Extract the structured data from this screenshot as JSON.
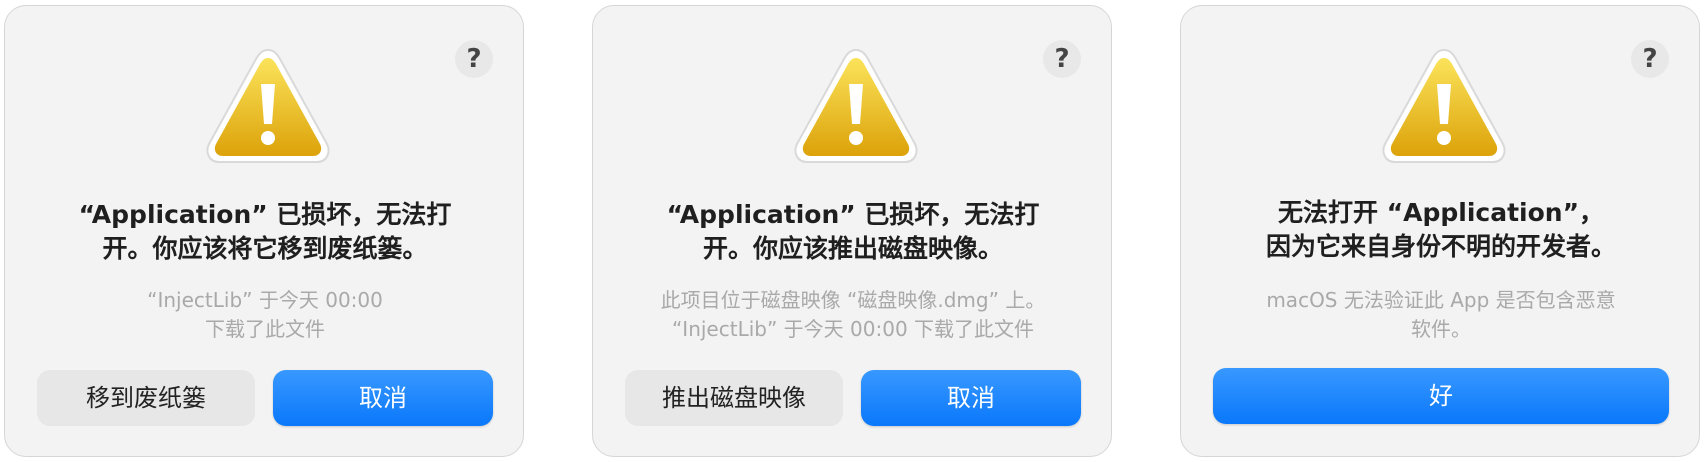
{
  "dialogs": [
    {
      "help": "?",
      "icon": "warning-triangle-icon",
      "title_line1": "“Application” 已损坏，无法打",
      "title_line2": "开。你应该将它移到废纸篓。",
      "message_line1": "“InjectLib” 于今天 00:00",
      "message_line2": "下载了此文件",
      "secondary_button": "移到废纸篓",
      "primary_button": "取消"
    },
    {
      "help": "?",
      "icon": "warning-triangle-icon",
      "title_line1": "“Application” 已损坏，无法打",
      "title_line2": "开。你应该推出磁盘映像。",
      "message_line1": "此项目位于磁盘映像 “磁盘映像.dmg” 上。",
      "message_line2": "“InjectLib” 于今天 00:00 下载了此文件",
      "secondary_button": "推出磁盘映像",
      "primary_button": "取消"
    },
    {
      "help": "?",
      "icon": "warning-triangle-icon",
      "title_line1": "无法打开 “Application”，",
      "title_line2": "因为它来自身份不明的开发者。",
      "message_line1": "macOS 无法验证此 App 是否包含恶意",
      "message_line2": "软件。",
      "primary_button": "好"
    }
  ],
  "colors": {
    "accent": "#0a78fb",
    "warning": "#e6b414"
  }
}
